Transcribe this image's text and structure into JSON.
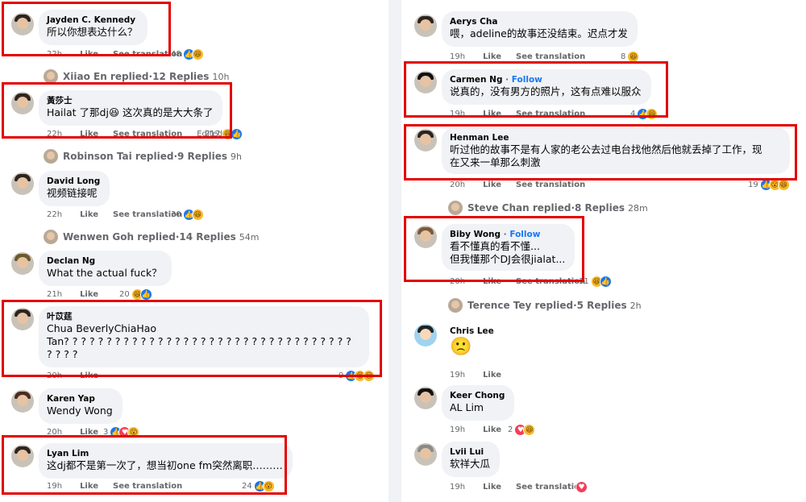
{
  "left": {
    "c1": {
      "author": "Jayden C. Kennedy",
      "text": "所以你想表达什么？",
      "time": "22h",
      "like": "Like",
      "see": "See translation",
      "count": "48"
    },
    "r1": {
      "name": "Xiiao En replied",
      "sep": " · ",
      "replies": "12 Replies",
      "time": "10h"
    },
    "c2": {
      "author": "黃莎士",
      "text": "Hailat 了那dj😆 这次真的是大大条了",
      "time": "22h",
      "like": "Like",
      "see": "See translation",
      "edited": "Edited",
      "count": "217"
    },
    "r2": {
      "name": "Robinson Tai replied",
      "sep": " · ",
      "replies": "9 Replies",
      "time": "9h"
    },
    "c3": {
      "author": "David Long",
      "text": "视频链接呢",
      "time": "22h",
      "like": "Like",
      "see": "See translation",
      "count": "30"
    },
    "r3": {
      "name": "Wenwen Goh replied",
      "sep": " · ",
      "replies": "14 Replies",
      "time": "54m"
    },
    "c4": {
      "author": "Declan Ng",
      "text": "What the actual fuck？",
      "time": "21h",
      "like": "Like",
      "count": "20"
    },
    "c5": {
      "author": "叶苡莛",
      "line1": "Chua BeverlyChiaHao",
      "line2": "Tan? ? ? ? ? ? ? ? ? ? ? ? ? ? ? ? ? ? ? ? ? ? ? ? ? ? ? ? ? ? ? ? ? ?",
      "line3": "? ? ? ?",
      "time": "20h",
      "like": "Like",
      "count": "9"
    },
    "c6": {
      "author": "Karen Yap",
      "text": "Wendy Wong",
      "time": "20h",
      "like": "Like",
      "count": "3"
    },
    "c7": {
      "author": "Lyan Lim",
      "text": "这dj都不是第一次了，想当初one fm突然离职………",
      "time": "19h",
      "like": "Like",
      "see": "See translation",
      "count": "24"
    }
  },
  "right": {
    "c1": {
      "author": "Aerys Cha",
      "text": "喂，adeline的故事还没结束。迟点才发",
      "time": "19h",
      "like": "Like",
      "see": "See translation",
      "count": "8"
    },
    "c2": {
      "author": "Carmen Ng",
      "follow": "Follow",
      "dot": " · ",
      "text": "说真的，没有男方的照片，这有点难以服众",
      "time": "19h",
      "like": "Like",
      "see": "See translation",
      "count": "4"
    },
    "c3": {
      "author": "Henman Lee",
      "line1": "听过他的故事不是有人家的老公去过电台找他然后他就丢掉了工作，现",
      "line2": "在又来一单那么刺激",
      "time": "20h",
      "like": "Like",
      "see": "See translation",
      "count": "19"
    },
    "r1": {
      "name": "Steve Chan replied",
      "sep": " · ",
      "replies": "8 Replies",
      "time": "28m"
    },
    "c4": {
      "author": "Biby Wong",
      "follow": "Follow",
      "dot": " · ",
      "line1": "看不懂真的看不懂...",
      "line2": "但我懂那个DJ会很jialat...",
      "time": "20h",
      "like": "Like",
      "see": "See translation",
      "count": "31"
    },
    "r2": {
      "name": "Terence Tey replied",
      "sep": " · ",
      "replies": "5 Replies",
      "time": "2h"
    },
    "c5": {
      "author": "Chris Lee",
      "text": "🙁",
      "time": "19h",
      "like": "Like"
    },
    "c6": {
      "author": "Keer Chong",
      "text": "AL Lim",
      "time": "19h",
      "like": "Like",
      "count": "2"
    },
    "c7": {
      "author": "Lvii Lui",
      "text": "软祥大瓜",
      "time": "19h",
      "like": "Like",
      "see": "See translation"
    }
  },
  "colors": {
    "highlight": "#e30000",
    "bubble": "#f0f2f5",
    "link": "#1877f2",
    "meta": "#65676b"
  }
}
